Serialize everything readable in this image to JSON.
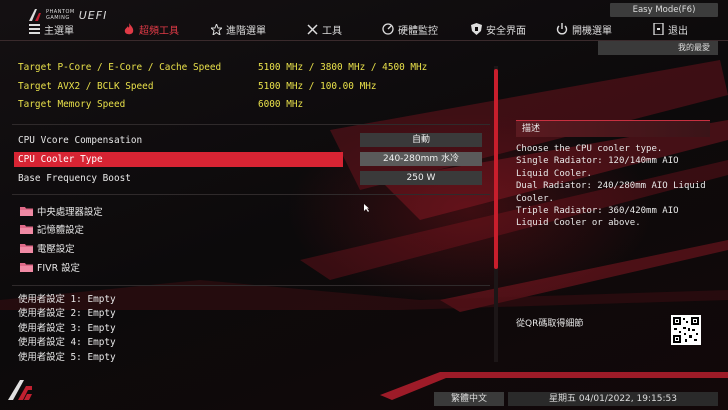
{
  "header": {
    "logo_small_top": "PHANTOM",
    "logo_small_bottom": "GAMING",
    "logo_uefi": "UEFI",
    "easy_mode": "Easy Mode(F6)"
  },
  "nav": {
    "items": [
      {
        "label": "主選單",
        "icon": "home-icon"
      },
      {
        "label": "超頻工具",
        "icon": "flame-icon",
        "active": true
      },
      {
        "label": "進階選單",
        "icon": "star-icon"
      },
      {
        "label": "工具",
        "icon": "tools-icon"
      },
      {
        "label": "硬體監控",
        "icon": "monitor-icon"
      },
      {
        "label": "安全界面",
        "icon": "shield-icon"
      },
      {
        "label": "開機選單",
        "icon": "power-icon"
      },
      {
        "label": "退出",
        "icon": "exit-icon"
      }
    ],
    "favorites": "我的最愛"
  },
  "targets": [
    {
      "label": "Target P-Core / E-Core / Cache Speed",
      "value": "5100 MHz / 3800 MHz / 4500 MHz"
    },
    {
      "label": "Target AVX2 / BCLK Speed",
      "value": "5100 MHz / 100.00 MHz"
    },
    {
      "label": "Target Memory Speed",
      "value": "6000 MHz"
    }
  ],
  "settings": [
    {
      "label": "CPU Vcore Compensation",
      "value": "自動"
    },
    {
      "label": "CPU Cooler Type",
      "value": "240-280mm 水冷",
      "selected": true
    },
    {
      "label": "Base Frequency Boost",
      "value": "250 W"
    }
  ],
  "folders": [
    {
      "label": "中央處理器設定"
    },
    {
      "label": "記憶體設定"
    },
    {
      "label": "電壓設定"
    },
    {
      "label": "FIVR 設定"
    }
  ],
  "profiles": [
    {
      "label": "使用者設定 1: Empty"
    },
    {
      "label": "使用者設定 2: Empty"
    },
    {
      "label": "使用者設定 3: Empty"
    },
    {
      "label": "使用者設定 4: Empty"
    },
    {
      "label": "使用者設定 5: Empty"
    }
  ],
  "description": {
    "title": "描述",
    "text": "Choose the CPU cooler type.\nSingle Radiator: 120/140mm AIO\nLiquid Cooler.\nDual Radiator: 240/280mm AIO Liquid\nCooler.\nTriple Radiator: 360/420mm AIO\nLiquid Cooler or above.",
    "qr_label": "從QR碼取得細節"
  },
  "footer": {
    "language": "繁體中文",
    "datetime": "星期五 04/01/2022, 19:15:53"
  },
  "colors": {
    "accent": "#d72433",
    "yellow_text": "#e8e04a",
    "button_bg": "#3a3a3a"
  }
}
